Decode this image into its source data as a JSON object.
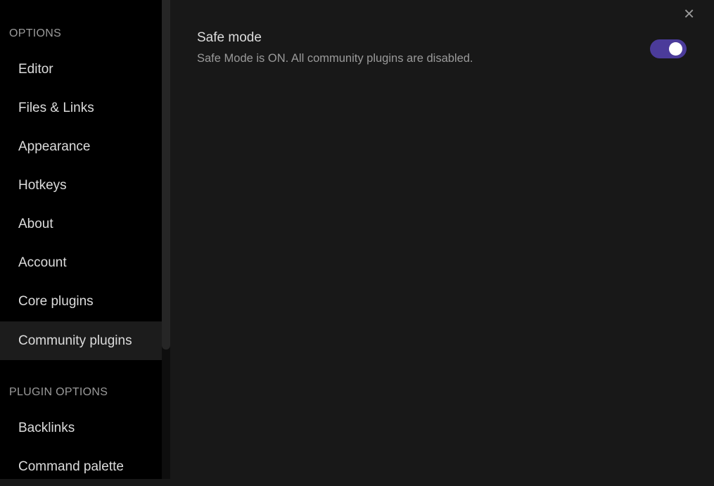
{
  "sidebar": {
    "options_heading": "OPTIONS",
    "items": [
      {
        "label": "Editor"
      },
      {
        "label": "Files & Links"
      },
      {
        "label": "Appearance"
      },
      {
        "label": "Hotkeys"
      },
      {
        "label": "About"
      },
      {
        "label": "Account"
      },
      {
        "label": "Core plugins"
      },
      {
        "label": "Community plugins",
        "active": true
      }
    ],
    "plugin_options_heading": "PLUGIN OPTIONS",
    "plugin_items": [
      {
        "label": "Backlinks"
      },
      {
        "label": "Command palette"
      }
    ]
  },
  "main": {
    "close_icon": "×",
    "safe_mode": {
      "title": "Safe mode",
      "description": "Safe Mode is ON. All community plugins are disabled.",
      "enabled": true
    }
  },
  "colors": {
    "accent": "#4b3b9a"
  }
}
